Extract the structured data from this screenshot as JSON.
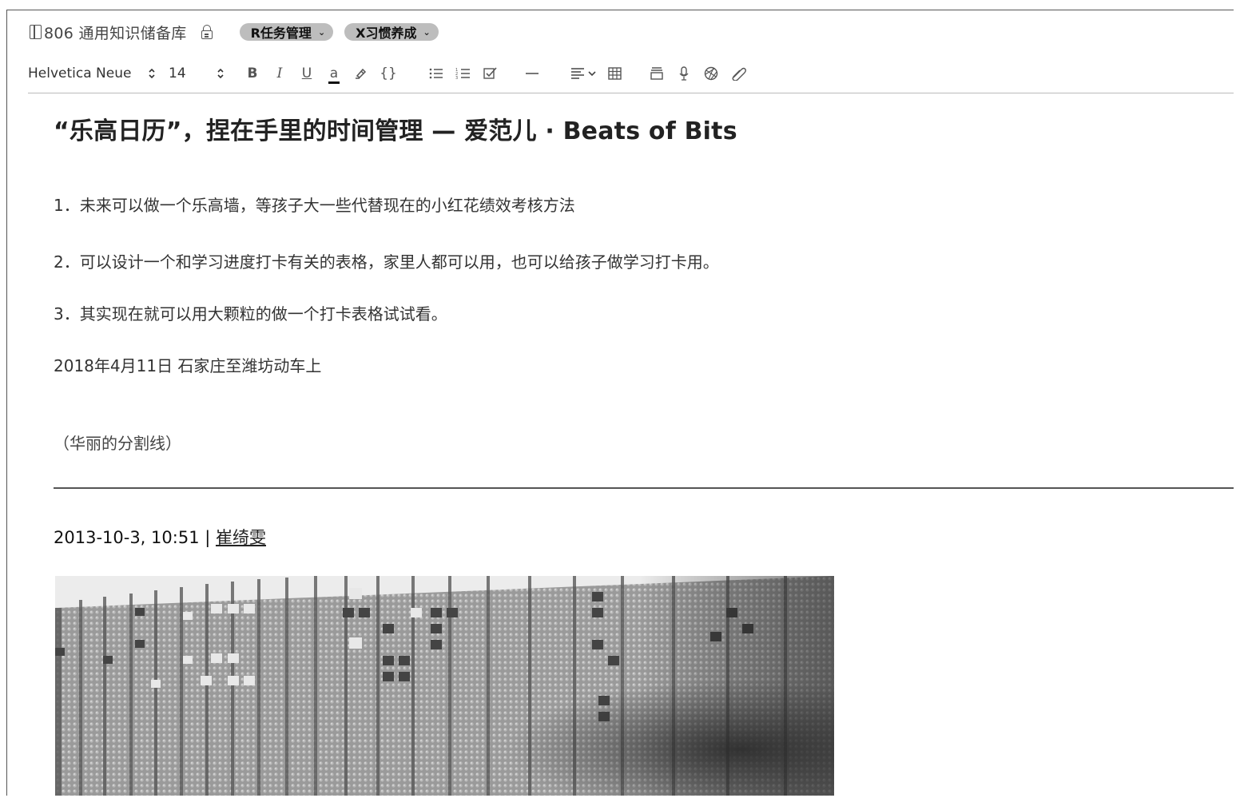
{
  "header": {
    "notebook_icon": "notebook-icon",
    "notebook_name": "806 通用知识储备库",
    "lock_icon": "lock-icon",
    "tags": [
      {
        "label": "R任务管理"
      },
      {
        "label": "X习惯养成"
      }
    ]
  },
  "toolbar": {
    "font_name": "Helvetica Neue",
    "font_size": "14",
    "stepper_glyph": "⌃⌄",
    "bold": "B",
    "italic": "I",
    "underline": "U",
    "text_color": "a",
    "highlighter_icon": "highlighter-icon",
    "code_label": "{}",
    "bullet_list_icon": "bullet-list-icon",
    "numbered_list_icon": "numbered-list-icon",
    "checklist_icon": "checklist-icon",
    "horizontal_rule_icon": "horizontal-rule-icon",
    "align_icon": "align-left-icon",
    "table_icon": "table-icon",
    "section_icon": "section-icon",
    "audio_icon": "microphone-icon",
    "sketch_icon": "sketch-icon",
    "attachment_icon": "paperclip-icon"
  },
  "note": {
    "title": "“乐高日历”，捏在手里的时间管理 — 爱范儿 · Beats of Bits",
    "items": [
      "1．未来可以做一个乐高墙，等孩子大一些代替现在的小红花绩效考核方法",
      "2．可以设计一个和学习进度打卡有关的表格，家里人都可以用，也可以给孩子做学习打卡用。",
      "3．其实现在就可以用大颗粒的做一个打卡表格试试看。"
    ],
    "date_line": "2018年4月11日 石家庄至潍坊动车上",
    "divider_label": "（华丽的分割线）",
    "clip_meta_prefix": "2013-10-3, 10:51 | ",
    "clip_author": "崔绮雯",
    "image_name": "lego-calendar-photo"
  },
  "colors": {
    "tag_bg": "#bdbdbd",
    "divider": "#555555",
    "text": "#222222"
  }
}
